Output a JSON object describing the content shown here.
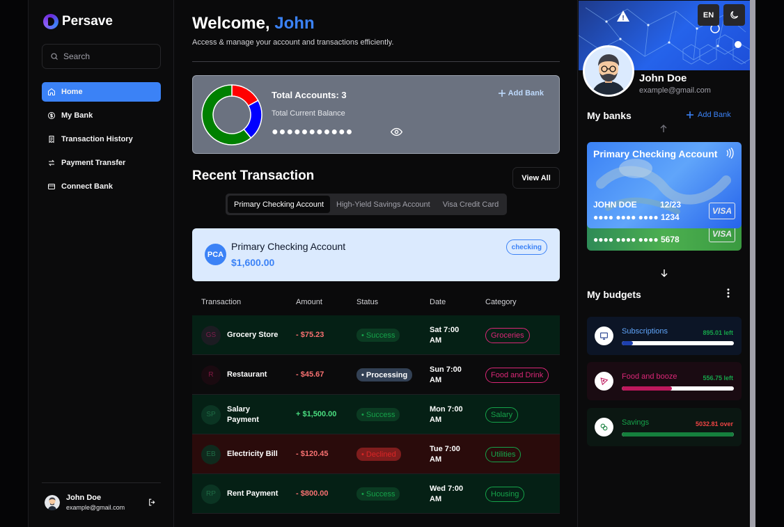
{
  "app": {
    "name": "Persave"
  },
  "search": {
    "placeholder": "Search"
  },
  "nav": [
    {
      "label": "Home",
      "icon": "home-icon",
      "active": true
    },
    {
      "label": "My Bank",
      "icon": "dollar-circle-icon"
    },
    {
      "label": "Transaction History",
      "icon": "receipt-icon"
    },
    {
      "label": "Payment Transfer",
      "icon": "transfer-icon"
    },
    {
      "label": "Connect Bank",
      "icon": "card-icon"
    }
  ],
  "user": {
    "name": "John Doe",
    "email": "example@gmail.com"
  },
  "header": {
    "greeting": "Welcome,",
    "name": "John",
    "subtitle": "Access & manage your account and transactions efficiently."
  },
  "balance": {
    "total_accounts": "Total Accounts: 3",
    "label": "Total Current Balance",
    "masked": "●●●●●●●●●●●",
    "add_bank": "Add Bank",
    "donut": [
      {
        "share": 0.17,
        "color": "#ff0000"
      },
      {
        "share": 0.22,
        "color": "#0000ff"
      },
      {
        "share": 0.61,
        "color": "#008000"
      }
    ]
  },
  "recent": {
    "title": "Recent Transaction",
    "view_all": "View All",
    "tabs": [
      "Primary Checking Account",
      "High-Yield Savings Account",
      "Visa Credit Card"
    ]
  },
  "account": {
    "initials": "PCA",
    "name": "Primary Checking Account",
    "balance": "$1,600.00",
    "type": "checking"
  },
  "table": {
    "headers": [
      "Transaction",
      "Amount",
      "Status",
      "Date",
      "Category"
    ],
    "rows": [
      {
        "initials": "GS",
        "name": "Grocery Store",
        "amount": "- $75.23",
        "sign": "neg",
        "status": "• Success",
        "status_kind": "success",
        "date": "Sat 7:00 AM",
        "category": "Groceries",
        "cat_color": "pink",
        "bg": "green"
      },
      {
        "initials": "R",
        "name": "Restaurant",
        "amount": "- $45.67",
        "sign": "neg",
        "status": "• Processing",
        "status_kind": "processing",
        "date": "Sun 7:00 AM",
        "category": "Food and Drink",
        "cat_color": "pink",
        "bg": "dark"
      },
      {
        "initials": "SP",
        "name": "Salary Payment",
        "amount": "+ $1,500.00",
        "sign": "pos",
        "status": "• Success",
        "status_kind": "success",
        "date": "Mon 7:00 AM",
        "category": "Salary",
        "cat_color": "green",
        "bg": "green"
      },
      {
        "initials": "EB",
        "name": "Electricity Bill",
        "amount": "- $120.45",
        "sign": "neg",
        "status": "• Declined",
        "status_kind": "declined",
        "date": "Tue 7:00 AM",
        "category": "Utilities",
        "cat_color": "green",
        "bg": "red"
      },
      {
        "initials": "RP",
        "name": "Rent Payment",
        "amount": "- $800.00",
        "sign": "neg",
        "status": "• Success",
        "status_kind": "success",
        "date": "Wed 7:00 AM",
        "category": "Housing",
        "cat_color": "green",
        "bg": "green"
      }
    ]
  },
  "right": {
    "lang": "EN",
    "profile_name": "John Doe",
    "profile_email": "example@gmail.com",
    "my_banks": "My banks",
    "add_bank": "Add Bank",
    "cards": [
      {
        "title": "Primary Checking Account",
        "holder": "JOHN DOE",
        "expiry": "12/23",
        "number": "●●●● ●●●● ●●●● 1234",
        "brand": "VISA"
      },
      {
        "title": "",
        "holder": "",
        "expiry": "",
        "number": "●●●● ●●●● ●●●● 5678",
        "brand": "VISA"
      }
    ],
    "my_budgets": "My budgets",
    "budgets": [
      {
        "name": "Subscriptions",
        "status": "895.01 left",
        "progress": 0.1,
        "icon": "monitor-icon"
      },
      {
        "name": "Food and booze",
        "status": "556.75 left",
        "progress": 0.45,
        "icon": "pizza-icon"
      },
      {
        "name": "Savings",
        "status": "5032.81 over",
        "progress": 1.0,
        "icon": "coins-icon"
      }
    ]
  },
  "colors": {
    "accent": "#3b82f6",
    "success": "#16a34a",
    "danger": "#ef4444",
    "pink": "#db2777"
  }
}
